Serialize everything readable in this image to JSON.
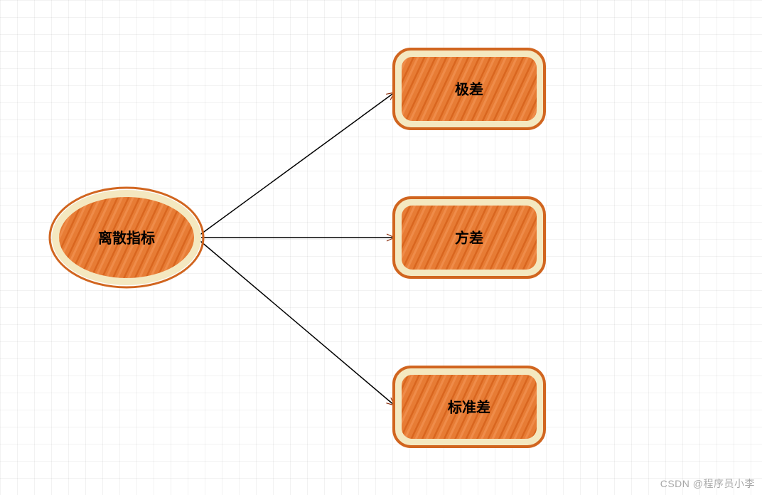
{
  "diagram": {
    "root": {
      "label": "离散指标"
    },
    "children": [
      {
        "label": "极差"
      },
      {
        "label": "方差"
      },
      {
        "label": "标准差"
      }
    ]
  },
  "colors": {
    "node_fill": "#e77c35",
    "node_inner_border": "#f4e8c0",
    "node_outer_border": "#d1651f",
    "arrow": "#000000",
    "arrow_head": "#8b2c0a"
  },
  "watermark": "CSDN @程序员小李"
}
